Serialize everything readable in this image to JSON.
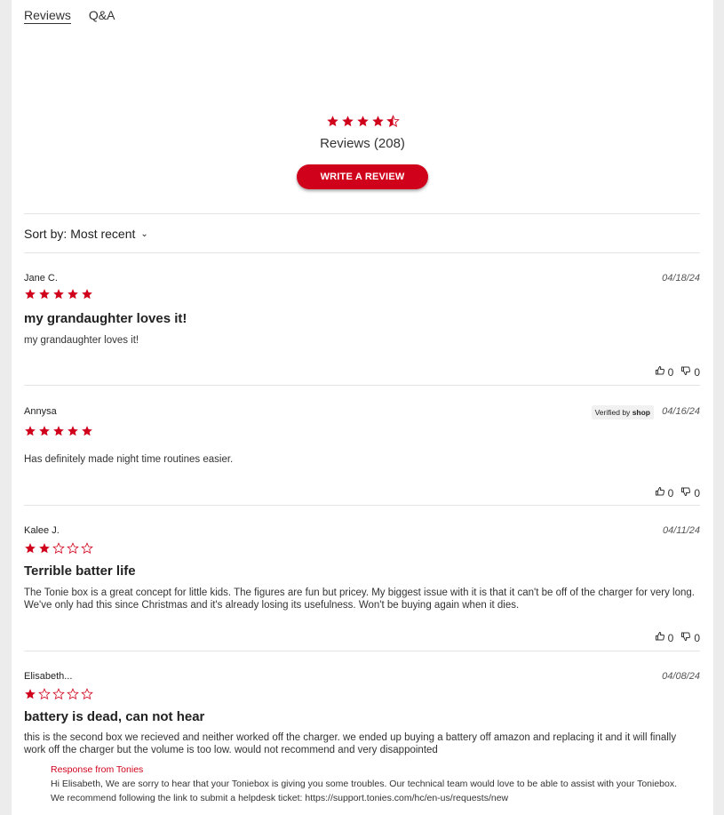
{
  "tabs": [
    {
      "label": "Reviews"
    },
    {
      "label": "Q&A"
    }
  ],
  "summary": {
    "rating": 4.5,
    "count_text": "Reviews (208)",
    "write_label": "WRITE A REVIEW"
  },
  "sort": {
    "label": "Sort by:",
    "value": "Most recent"
  },
  "colors": {
    "accent": "#d0021b"
  },
  "reviews": [
    {
      "author": "Jane C.",
      "date": "04/18/24",
      "rating": 5,
      "title": "my grandaughter loves it!",
      "body": "my grandaughter loves it!",
      "up": "0",
      "down": "0"
    },
    {
      "author": "Annysa",
      "date": "04/16/24",
      "rating": 5,
      "title": "",
      "body": "Has definitely made night time routines easier.",
      "verified_prefix": "Verified by",
      "verified_brand": "shop",
      "up": "0",
      "down": "0"
    },
    {
      "author": "Kalee J.",
      "date": "04/11/24",
      "rating": 2,
      "title": "Terrible batter life",
      "body": "The Tonie box is a great concept for little kids. The figures are fun but pricey. My biggest issue with it is that it can't be off of the charger for very long. We've only had this since Christmas and it's already losing its usefulness. Won't be buying again when it dies.",
      "up": "0",
      "down": "0"
    },
    {
      "author": "Elisabeth...",
      "date": "04/08/24",
      "rating": 1,
      "title": "battery is dead, can not hear",
      "body": "this is the second box we recieved and neither worked off the charger. we ended up buying a battery off amazon and replacing it and it will finally work off the charger but the volume is too low. would not recommend and very disappointed",
      "response_label": "Response from Tonies",
      "response_line1": "Hi Elisabeth, We are sorry to hear that your Toniebox is giving you some troubles. Our technical team would love to be able to assist with your Toniebox.",
      "response_line2": "We recommend following the link to submit a helpdesk ticket: https://support.tonies.com/hc/en-us/requests/new"
    }
  ]
}
